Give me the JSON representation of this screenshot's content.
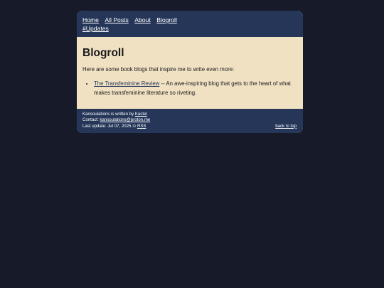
{
  "nav": {
    "items": [
      "Home",
      "All Posts",
      "About",
      "Blogroll",
      "#Updates"
    ]
  },
  "main": {
    "title": "Blogroll",
    "intro": "Here are some book blogs that inspire me to write even more:",
    "links": [
      {
        "title": "The Transfeminine Review",
        "description": " -- An awe-inspiring blog that gets to the heart of what makes transfeminine literature so riveting."
      }
    ]
  },
  "footer": {
    "written_prefix": "Kansoulations is written by ",
    "author": "Kastel",
    "contact_prefix": "Contact: ",
    "email": "kansoulations@proton.me",
    "update_prefix": "Last update: Jul 07, 2025 ⊙ ",
    "rss": "RSS",
    "back_to_top": "back to top"
  },
  "colors": {
    "page_bg": "#171a28",
    "header_bg": "#253659",
    "content_bg": "#f0e1c3"
  }
}
